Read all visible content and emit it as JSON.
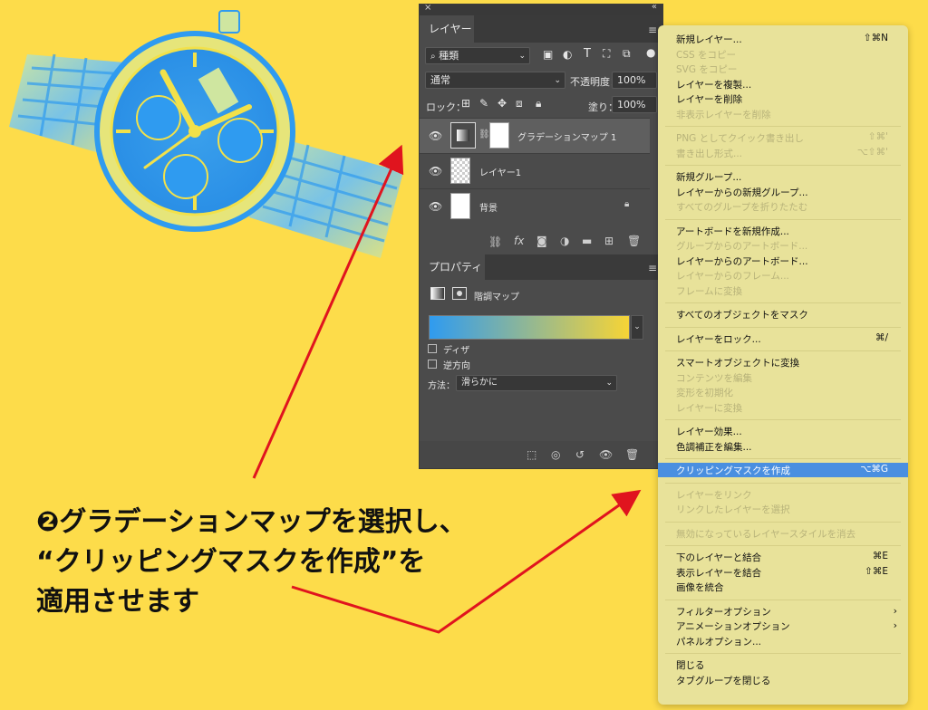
{
  "layers_panel": {
    "close": "×",
    "collapse": "«",
    "tab": "レイヤー",
    "panel_menu": "≡",
    "filter_value": "種類",
    "blend_mode": "通常",
    "opacity_label": "不透明度：",
    "opacity_value": "100%",
    "lock_label": "ロック：",
    "fill_label": "塗り：",
    "fill_value": "100%",
    "layers": [
      {
        "name": "グラデーションマップ 1",
        "selected": true
      },
      {
        "name": "レイヤー1",
        "selected": false
      },
      {
        "name": "背景",
        "selected": false
      }
    ]
  },
  "properties_panel": {
    "tab": "プロパティ",
    "type_label": "階調マップ",
    "gradient_colors": [
      "#2f9bf0",
      "#f6d436"
    ],
    "dither_label": "ディザ",
    "reverse_label": "逆方向",
    "method_label": "方法：",
    "method_value": "滑らかに"
  },
  "context_menu": {
    "items": [
      {
        "label": "新規レイヤー...",
        "shortcut": "⇧⌘N",
        "enabled": true
      },
      {
        "label": "CSS をコピー",
        "shortcut": "",
        "enabled": false
      },
      {
        "label": "SVG をコピー",
        "shortcut": "",
        "enabled": false
      },
      {
        "label": "レイヤーを複製...",
        "shortcut": "",
        "enabled": true
      },
      {
        "label": "レイヤーを削除",
        "shortcut": "",
        "enabled": true
      },
      {
        "label": "非表示レイヤーを削除",
        "shortcut": "",
        "enabled": false
      },
      {
        "label": "PNG としてクイック書き出し",
        "shortcut": "⇧⌘'",
        "enabled": false
      },
      {
        "label": "書き出し形式...",
        "shortcut": "⌥⇧⌘'",
        "enabled": false
      },
      {
        "label": "新規グループ...",
        "shortcut": "",
        "enabled": true
      },
      {
        "label": "レイヤーからの新規グループ...",
        "shortcut": "",
        "enabled": true
      },
      {
        "label": "すべてのグループを折りたたむ",
        "shortcut": "",
        "enabled": false
      },
      {
        "label": "アートボードを新規作成...",
        "shortcut": "",
        "enabled": true
      },
      {
        "label": "グループからのアートボード...",
        "shortcut": "",
        "enabled": false
      },
      {
        "label": "レイヤーからのアートボード...",
        "shortcut": "",
        "enabled": true
      },
      {
        "label": "レイヤーからのフレーム...",
        "shortcut": "",
        "enabled": false
      },
      {
        "label": "フレームに変換",
        "shortcut": "",
        "enabled": false
      },
      {
        "label": "すべてのオブジェクトをマスク",
        "shortcut": "",
        "enabled": true
      },
      {
        "label": "レイヤーをロック...",
        "shortcut": "⌘/",
        "enabled": true
      },
      {
        "label": "スマートオブジェクトに変換",
        "shortcut": "",
        "enabled": true
      },
      {
        "label": "コンテンツを編集",
        "shortcut": "",
        "enabled": false
      },
      {
        "label": "変形を初期化",
        "shortcut": "",
        "enabled": false
      },
      {
        "label": "レイヤーに変換",
        "shortcut": "",
        "enabled": false
      },
      {
        "label": "レイヤー効果...",
        "shortcut": "",
        "enabled": true
      },
      {
        "label": "色調補正を編集...",
        "shortcut": "",
        "enabled": true
      },
      {
        "label": "クリッピングマスクを作成",
        "shortcut": "⌥⌘G",
        "enabled": true,
        "highlighted": true
      },
      {
        "label": "レイヤーをリンク",
        "shortcut": "",
        "enabled": false
      },
      {
        "label": "リンクしたレイヤーを選択",
        "shortcut": "",
        "enabled": false
      },
      {
        "label": "無効になっているレイヤースタイルを消去",
        "shortcut": "",
        "enabled": false
      },
      {
        "label": "下のレイヤーと結合",
        "shortcut": "⌘E",
        "enabled": true
      },
      {
        "label": "表示レイヤーを結合",
        "shortcut": "⇧⌘E",
        "enabled": true
      },
      {
        "label": "画像を統合",
        "shortcut": "",
        "enabled": true
      },
      {
        "label": "フィルターオプション",
        "shortcut": "",
        "enabled": true,
        "submenu": true
      },
      {
        "label": "アニメーションオプション",
        "shortcut": "",
        "enabled": true,
        "submenu": true
      },
      {
        "label": "パネルオプション...",
        "shortcut": "",
        "enabled": true
      },
      {
        "label": "閉じる",
        "shortcut": "",
        "enabled": true
      },
      {
        "label": "タブグループを閉じる",
        "shortcut": "",
        "enabled": true
      }
    ]
  },
  "annotation": {
    "marker": "❷",
    "line1": "グラデーションマップを選択し、",
    "line2": "“クリッピングマスクを作成”を",
    "line3": "適用させます"
  },
  "colors": {
    "background": "#fddc4a",
    "arrow": "#e0141e",
    "highlight": "#4a8fe0",
    "menu_bg": "#e8e29a"
  }
}
